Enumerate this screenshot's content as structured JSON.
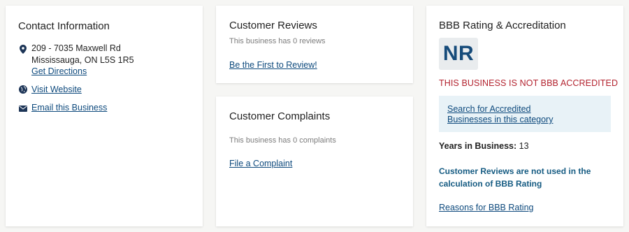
{
  "contact": {
    "title": "Contact Information",
    "address_line1": "209 - 7035 Maxwell Rd",
    "address_line2": "Mississauga, ON L5S 1R5",
    "get_directions": "Get Directions",
    "visit_website": "Visit Website",
    "email_business": "Email this Business",
    "icons": [
      "map-pin-icon",
      "globe-icon",
      "envelope-icon"
    ]
  },
  "reviews": {
    "title": "Customer Reviews",
    "count_text": "This business has 0 reviews",
    "cta": "Be the First to Review!"
  },
  "complaints": {
    "title": "Customer Complaints",
    "count_text": "This business has 0 complaints",
    "cta": "File a Complaint"
  },
  "rating": {
    "title": "BBB Rating & Accreditation",
    "grade": "NR",
    "status": "THIS BUSINESS IS NOT BBB ACCREDITED",
    "search_link": "Search for Accredited Businesses in this category",
    "years_label": "Years in Business:",
    "years_value": "13",
    "notice": "Customer Reviews are not used in the calculation of BBB Rating",
    "reasons_link": "Reasons for BBB Rating"
  },
  "colors": {
    "link": "#0e4a7d",
    "not_accredited": "#b3232f",
    "notice": "#155b82",
    "search_box_bg": "#e8f2f7",
    "badge_bg": "#e9ecee",
    "badge_text": "#164b7a"
  }
}
